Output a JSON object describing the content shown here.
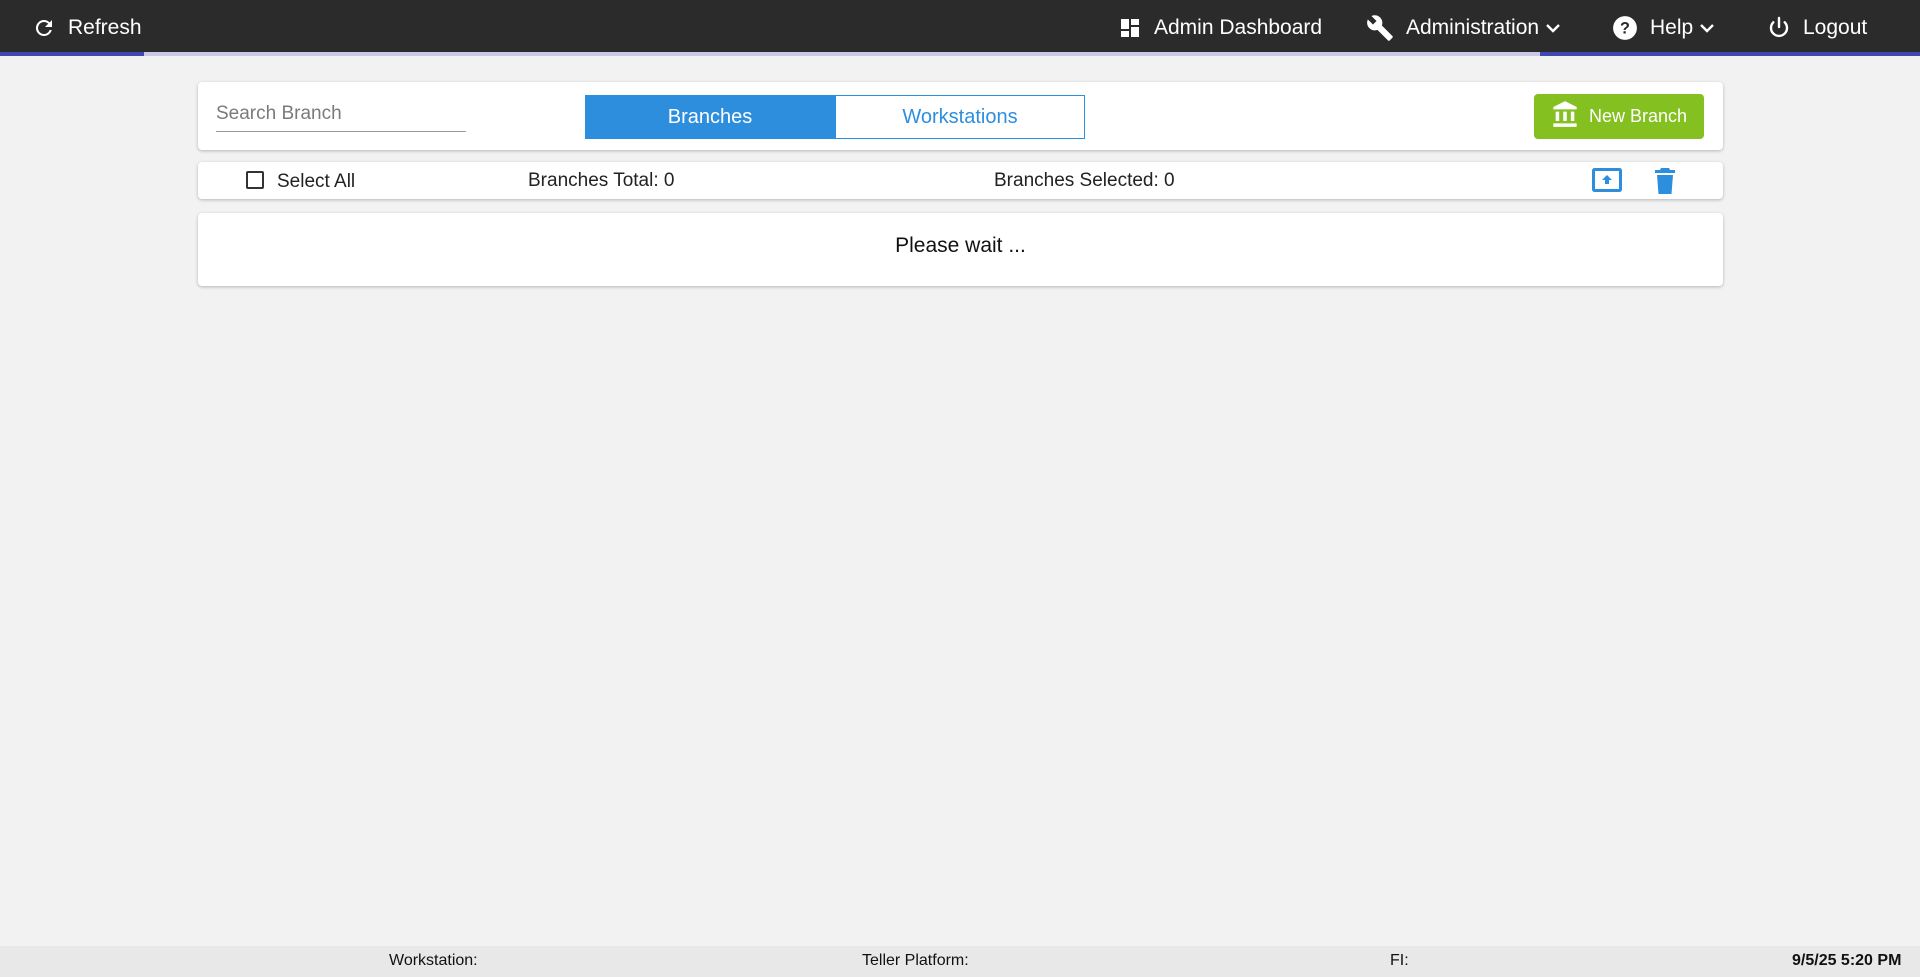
{
  "header": {
    "refresh_label": "Refresh",
    "admin_dashboard_label": "Admin Dashboard",
    "administration_label": "Administration",
    "help_label": "Help",
    "logout_label": "Logout"
  },
  "toolbar": {
    "search_placeholder": "Search Branch",
    "search_value": "",
    "tabs": [
      {
        "label": "Branches",
        "active": true
      },
      {
        "label": "Workstations",
        "active": false
      }
    ],
    "new_branch_label": "New Branch"
  },
  "list_header": {
    "select_all_label": "Select All",
    "select_all_checked": false,
    "branches_total": "Branches Total: 0",
    "branches_selected": "Branches Selected: 0"
  },
  "content": {
    "status_message": "Please wait ..."
  },
  "footer": {
    "workstation": "Workstation:",
    "teller_platform": "Teller Platform:",
    "fi": "FI:",
    "timestamp": "9/5/25 5:20 PM"
  },
  "icons": {
    "refresh": "refresh-icon",
    "dashboard": "dashboard-icon",
    "wrench": "wrench-icon",
    "help": "help-icon",
    "power": "power-icon",
    "bank": "bank-icon",
    "upload": "upload-icon",
    "trash": "trash-icon"
  },
  "colors": {
    "topbar": "#2b2b2b",
    "accent_blue": "#2e8ede",
    "new_branch_green": "#83c020",
    "progress": "#3f48b5"
  }
}
